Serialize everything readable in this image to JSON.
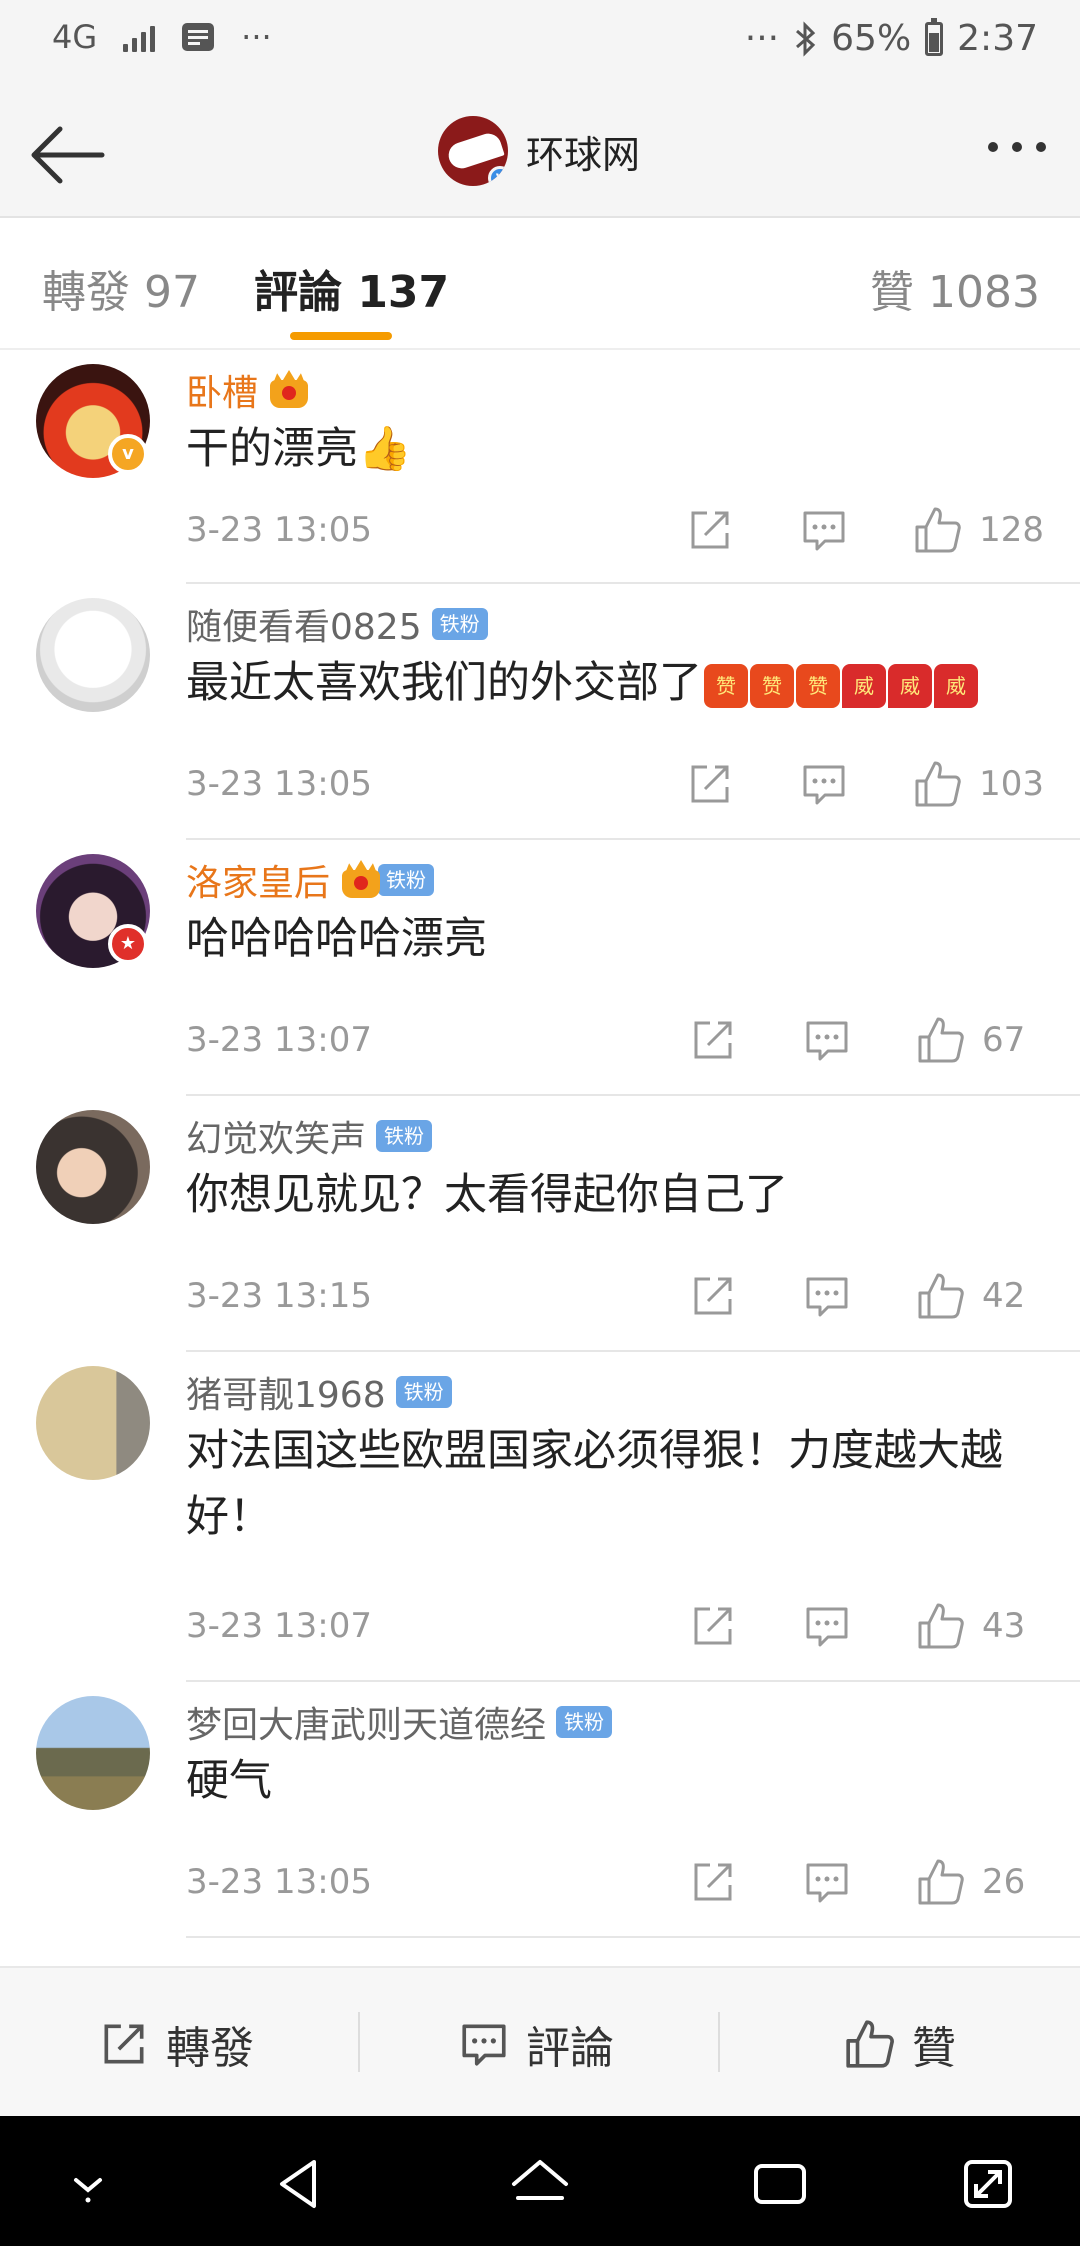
{
  "status_bar": {
    "network": "4G",
    "battery_percent": "65%",
    "time": "2:37",
    "dots": "···",
    "battery_level": 0.65
  },
  "header": {
    "account_name": "环球网",
    "verified_badge": "v"
  },
  "tabs": [
    {
      "label": "轉發 97",
      "active": false
    },
    {
      "label": "評論 137",
      "active": true
    },
    {
      "label": "贊 1083",
      "active": false
    }
  ],
  "comments": [
    {
      "user": "卧槽",
      "vip": true,
      "fan_badge": "",
      "text": "干的漂亮",
      "text_suffix": "👍",
      "time": "3-23 13:05",
      "likes": "128",
      "avatar_badge": "v",
      "badge_color": "#f5a623"
    },
    {
      "user": "随便看看0825",
      "vip": false,
      "fan_badge": "铁粉",
      "text": "最近太喜欢我们的外交部了",
      "stickers": [
        "赞",
        "赞",
        "赞",
        "威",
        "威",
        "威"
      ],
      "time": "3-23 13:05",
      "likes": "103"
    },
    {
      "user": "洛家皇后",
      "vip": true,
      "fan_badge": "铁粉",
      "text": "哈哈哈哈哈漂亮",
      "time": "3-23 13:07",
      "likes": "67",
      "avatar_badge": "★",
      "badge_color": "#e0302a"
    },
    {
      "user": "幻觉欢笑声",
      "vip": false,
      "fan_badge": "铁粉",
      "text": "你想见就见？太看得起你自己了",
      "time": "3-23 13:15",
      "likes": "42"
    },
    {
      "user": "猪哥靓1968",
      "vip": false,
      "fan_badge": "铁粉",
      "text": "对法国这些欧盟国家必须得狠！力度越大越好！",
      "time": "3-23 13:07",
      "likes": "43"
    },
    {
      "user": "梦回大唐武则天道德经",
      "vip": false,
      "fan_badge": "铁粉",
      "text": "硬气",
      "time": "3-23 13:05",
      "likes": "26"
    }
  ],
  "bottom_bar": {
    "repost_label": "轉發",
    "comment_label": "評論",
    "like_label": "贊"
  },
  "colors": {
    "accent": "#f59b00",
    "vip_name": "#e8761a",
    "fan_badge": "#6aa5e6",
    "brand_red": "#8b1a1a"
  },
  "icons": [
    "back-arrow-icon",
    "more-icon",
    "share-icon",
    "comment-icon",
    "like-icon",
    "nav-down-icon",
    "nav-back-icon",
    "nav-home-icon",
    "nav-recents-icon",
    "nav-expand-icon"
  ]
}
